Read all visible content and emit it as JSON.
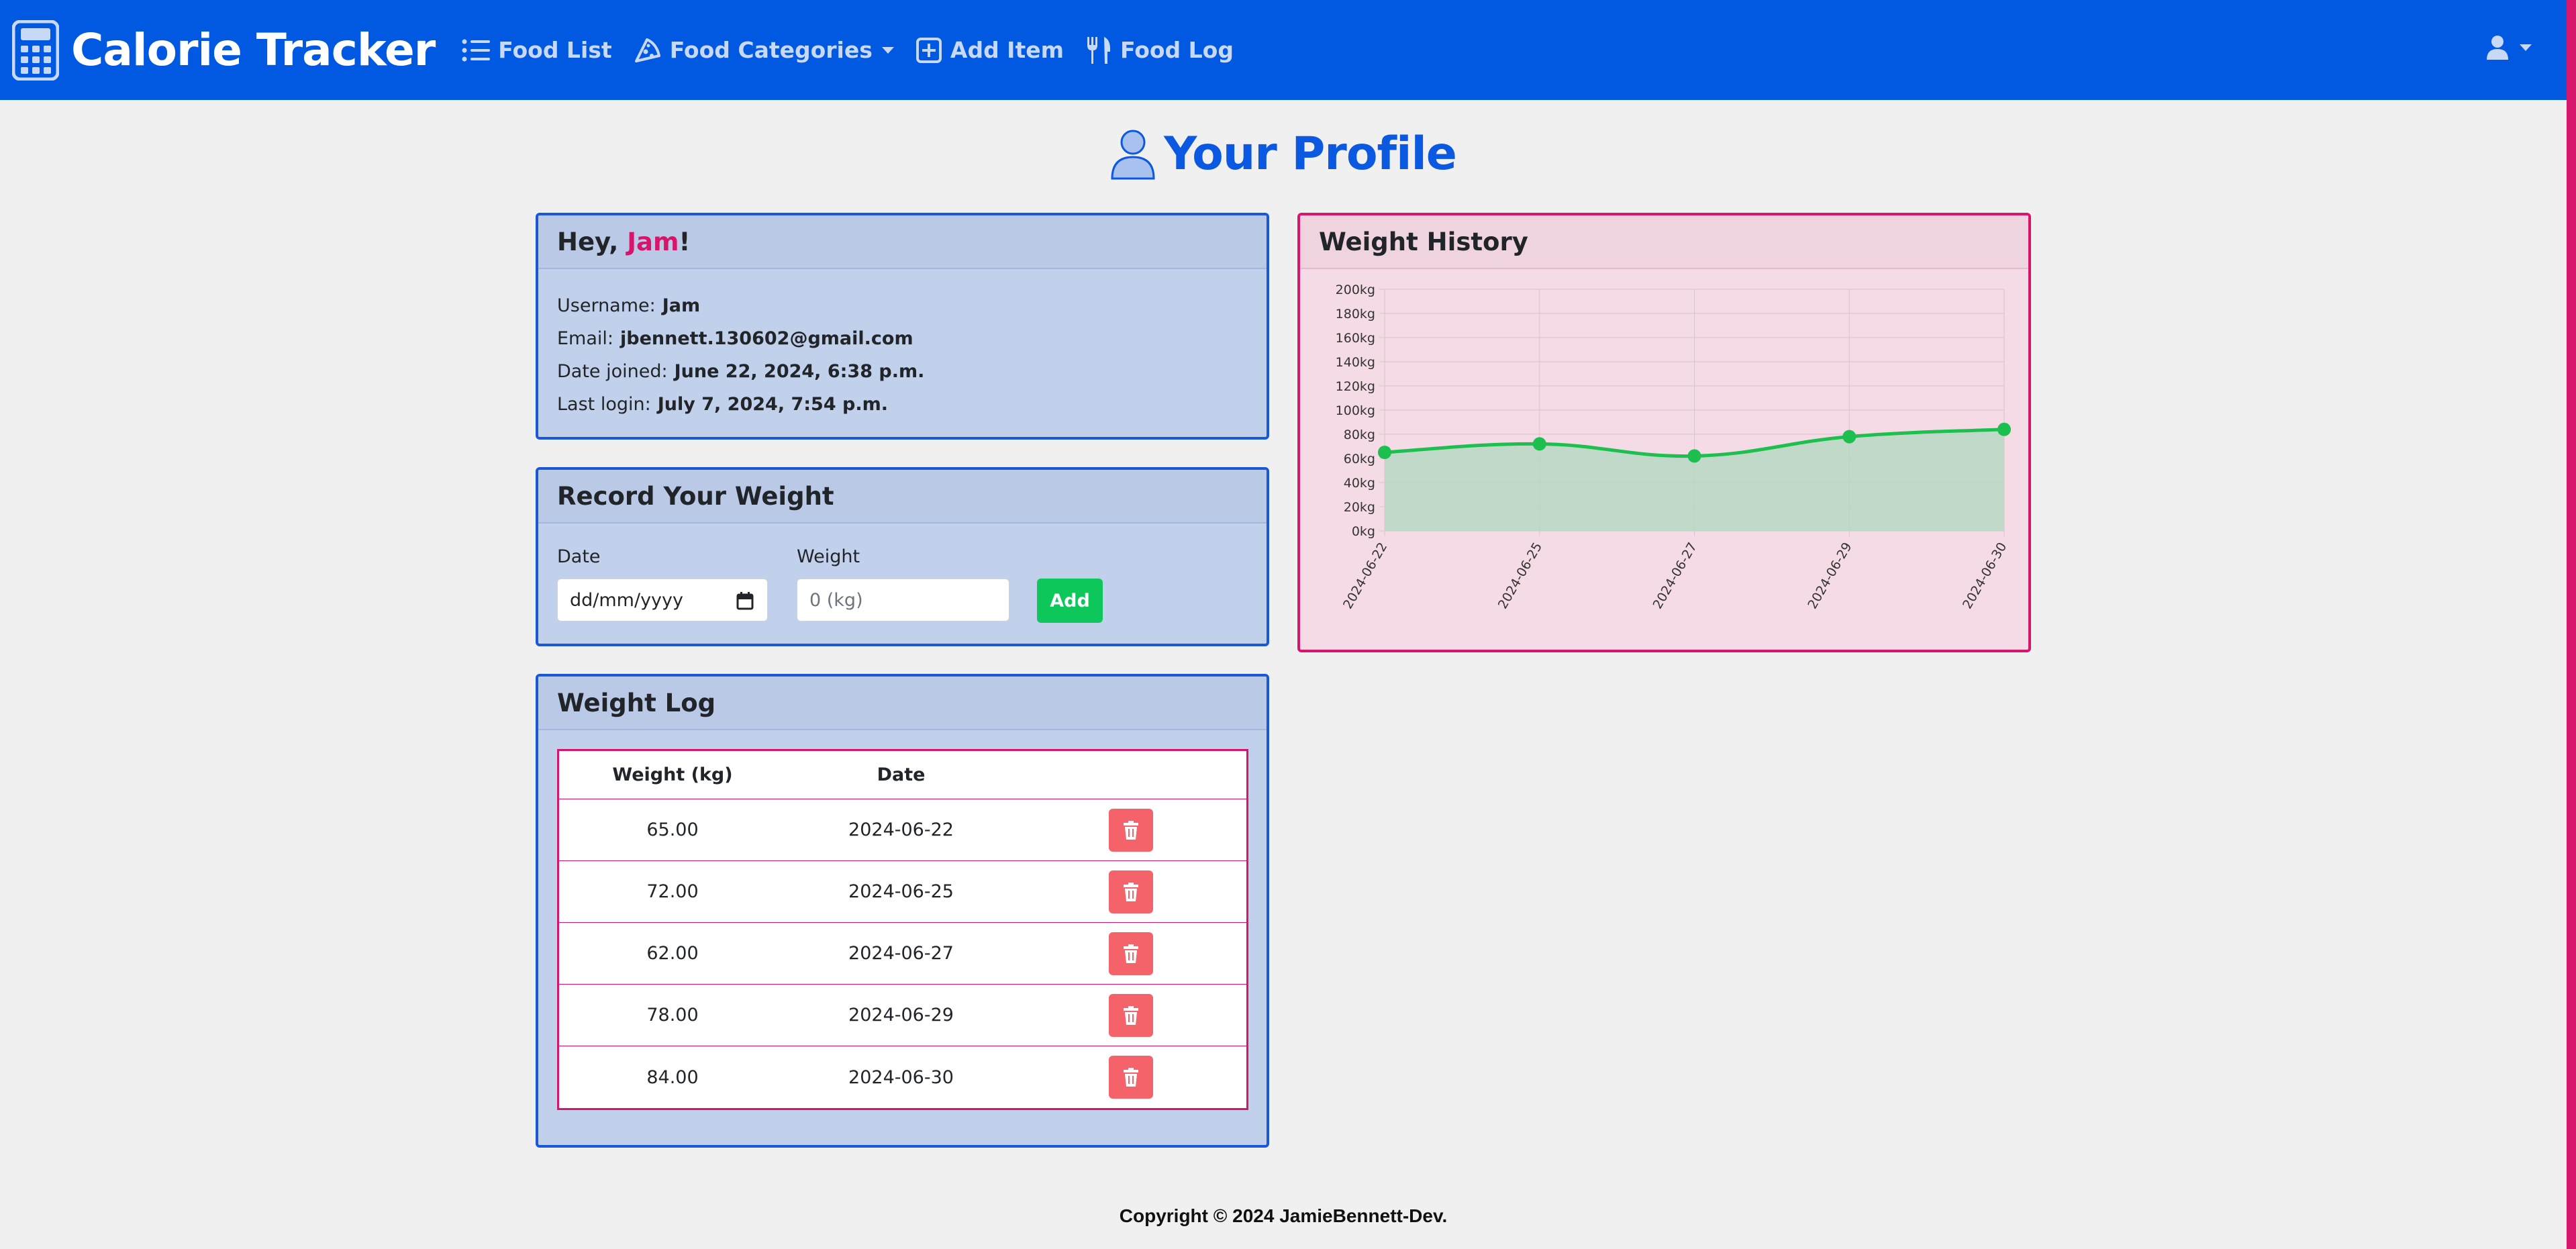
{
  "navbar": {
    "brand": "Calorie Tracker",
    "items": [
      {
        "label": "Food List",
        "icon": "list-icon"
      },
      {
        "label": "Food Categories",
        "icon": "pizza-icon",
        "dropdown": true
      },
      {
        "label": "Add Item",
        "icon": "plus-square-icon"
      },
      {
        "label": "Food Log",
        "icon": "utensils-icon"
      }
    ]
  },
  "page": {
    "title": "Your Profile"
  },
  "profile": {
    "greeting_prefix": "Hey, ",
    "greeting_name": "Jam",
    "greeting_suffix": "!",
    "username_label": "Username:",
    "username": "Jam",
    "email_label": "Email:",
    "email": "jbennett.130602@gmail.com",
    "joined_label": "Date joined:",
    "joined": "June 22, 2024, 6:38 p.m.",
    "login_label": "Last login:",
    "login": "July 7, 2024, 7:54 p.m."
  },
  "record": {
    "title": "Record Your Weight",
    "date_label": "Date",
    "date_placeholder": "dd/mm/yyyy",
    "weight_label": "Weight",
    "weight_placeholder": "0 (kg)",
    "add_label": "Add"
  },
  "log": {
    "title": "Weight Log",
    "headers": [
      "Weight (kg)",
      "Date"
    ],
    "rows": [
      {
        "weight": "65.00",
        "date": "2024-06-22"
      },
      {
        "weight": "72.00",
        "date": "2024-06-25"
      },
      {
        "weight": "62.00",
        "date": "2024-06-27"
      },
      {
        "weight": "78.00",
        "date": "2024-06-29"
      },
      {
        "weight": "84.00",
        "date": "2024-06-30"
      }
    ]
  },
  "history": {
    "title": "Weight History"
  },
  "chart_data": {
    "type": "area",
    "title": "",
    "categories": [
      "2024-06-22",
      "2024-06-25",
      "2024-06-27",
      "2024-06-29",
      "2024-06-30"
    ],
    "series": [
      {
        "values": [
          65,
          72,
          62,
          78,
          84
        ]
      }
    ],
    "ylim": [
      0,
      200
    ],
    "ytick_step": 20,
    "ytick_suffix": "kg",
    "grid": true,
    "line_color": "#1dbf4f",
    "fill_color": "#b7d8c4"
  },
  "footer": {
    "text": "Copyright © 2024 JamieBennett-Dev."
  }
}
